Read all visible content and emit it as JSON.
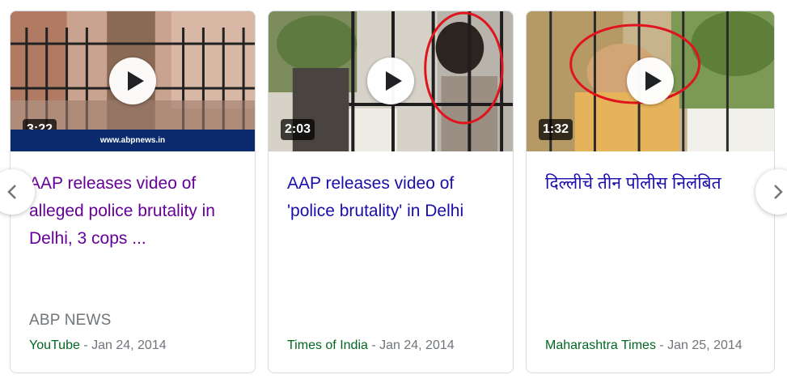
{
  "cards": [
    {
      "duration": "3:22",
      "watermark": "www.abpnews.in",
      "title": "AAP releases video of alleged police brutality in Delhi, 3 cops ...",
      "publisher": "ABP NEWS",
      "source": "YouTube",
      "date": " - Jan 24, 2014"
    },
    {
      "duration": "2:03",
      "title": "AAP releases video of 'police brutality' in Delhi",
      "source": "Times of India",
      "date": " - Jan 24, 2014"
    },
    {
      "duration": "1:32",
      "title": "दिल्लीचे तीन पोलीस निलंबित",
      "source": "Maharashtra Times",
      "date": " - Jan 25, 2014"
    }
  ],
  "nav": {
    "prev_icon": "chevron-left-icon",
    "next_icon": "chevron-right-icon"
  },
  "colors": {
    "link": "#1a0dab",
    "visited_link": "#660099",
    "source_green": "#006621",
    "meta_gray": "#70757a"
  }
}
